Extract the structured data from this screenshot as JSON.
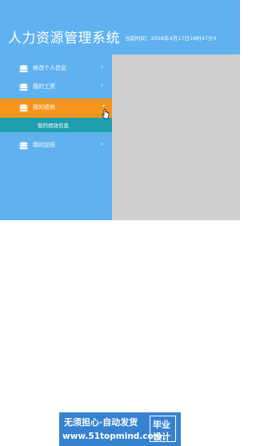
{
  "header": {
    "title": "人力资源管理系统",
    "current_time": "当前时间：2018年4月17日16时47分3"
  },
  "sidebar": {
    "items": [
      {
        "label": "修改个人信息",
        "icon": "database-icon",
        "arrow": "›",
        "active": false
      },
      {
        "label": "我的工资",
        "icon": "database-icon",
        "arrow": "›",
        "active": false
      },
      {
        "label": "我的绩效",
        "icon": "database-icon",
        "arrow": "⌄",
        "active": true
      },
      {
        "label": "我的加班",
        "icon": "database-icon",
        "arrow": "›",
        "active": false
      }
    ],
    "subitems": [
      {
        "label": "我的绩效信息"
      }
    ]
  },
  "watermark": {
    "line1": "无须担心·自动发货",
    "line2": "www.51topmind.com",
    "badge_line1": "毕业",
    "badge_line2": "设计"
  },
  "colors": {
    "header_bg": "#5fb2ef",
    "sidebar_bg": "#5fb2ef",
    "active_item_bg": "#f5951d",
    "submenu_bg": "#1f9fae",
    "content_bg": "#cfcfcf",
    "watermark_bg": "#2677cc"
  }
}
